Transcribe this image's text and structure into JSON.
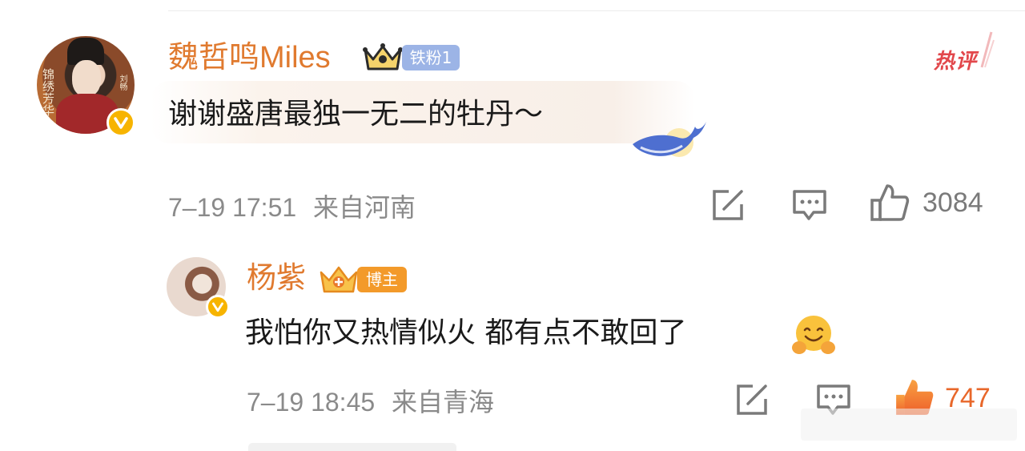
{
  "comment": {
    "username": "魏哲鸣Miles",
    "fan_badge": "铁粉1",
    "hot_tag": "热评",
    "text": "谢谢盛唐最独一无二的牡丹～",
    "time": "7–19 17:51",
    "location": "来自河南",
    "like_count": "3084",
    "avatar_calligraphy": "锦绣芳华",
    "avatar_name": "刘畅"
  },
  "reply": {
    "username": "杨紫",
    "badge": "博主",
    "text": "我怕你又热情似火 都有点不敢回了",
    "time": "7–19 18:45",
    "location": "来自青海",
    "like_count": "747"
  },
  "colors": {
    "username": "#e07a2f",
    "meta": "#8a8a8a",
    "hot_tag": "#e2474b",
    "verified_badge": "#f7b400",
    "fan_badge_bg": "#9cb4e6",
    "host_badge_bg": "#f39a2a",
    "liked_icon": "#f08a3c"
  },
  "icons": {
    "share": "share-edit-icon",
    "comment": "comment-icon",
    "like": "thumbs-up-icon",
    "hug_emoji": "hug-emoji-icon",
    "crown": "crown-icon",
    "whale": "whale-icon"
  }
}
